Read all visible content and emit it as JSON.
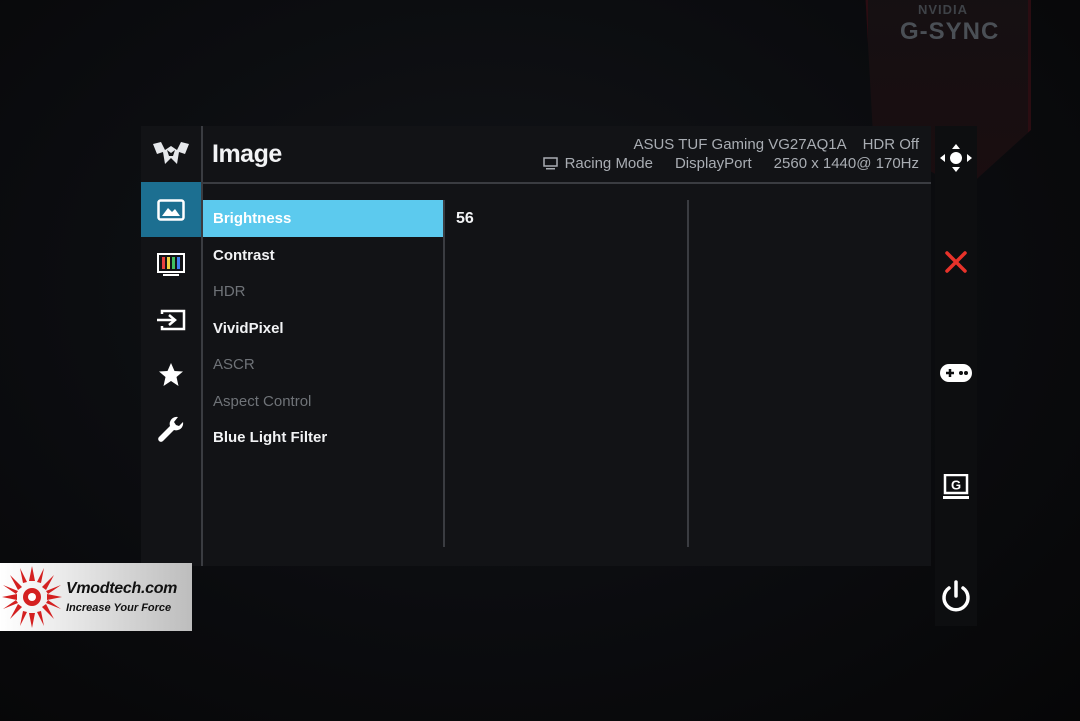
{
  "background": {
    "brand_top": "NVIDIA",
    "brand_bottom": "G-SYNC"
  },
  "osd": {
    "logo_icon": "tuf-gaming-logo",
    "page_title": "Image",
    "info": {
      "model": "ASUS TUF Gaming VG27AQ1A",
      "hdr_status": "HDR Off",
      "mode_icon": "monitor-icon",
      "mode": "Racing Mode",
      "input": "DisplayPort",
      "resolution": "2560 x 1440@ 170Hz"
    },
    "categories": [
      {
        "icon": "image-icon",
        "active": true
      },
      {
        "icon": "color-bars-icon",
        "active": false
      },
      {
        "icon": "input-select-icon",
        "active": false
      },
      {
        "icon": "star-icon",
        "active": false
      },
      {
        "icon": "wrench-icon",
        "active": false
      }
    ],
    "menu": [
      {
        "label": "Brightness",
        "state": "selected"
      },
      {
        "label": "Contrast",
        "state": "enabled"
      },
      {
        "label": "HDR",
        "state": "disabled"
      },
      {
        "label": "VividPixel",
        "state": "enabled"
      },
      {
        "label": "ASCR",
        "state": "disabled"
      },
      {
        "label": "Aspect Control",
        "state": "disabled"
      },
      {
        "label": "Blue Light Filter",
        "state": "enabled"
      }
    ],
    "selected_value": "56"
  },
  "key_guide": {
    "icons": [
      "joystick-icon",
      "close-icon",
      "gamepad-icon",
      "gameplus-icon",
      "power-icon"
    ],
    "gameplus_letter": "G",
    "close_color": "#e8322a"
  },
  "colors": {
    "active_category": "#1c6f91",
    "selected_item": "#5ccaee"
  },
  "watermark": {
    "site": "Vmodtech.com",
    "slogan": "Increase Your Force"
  }
}
